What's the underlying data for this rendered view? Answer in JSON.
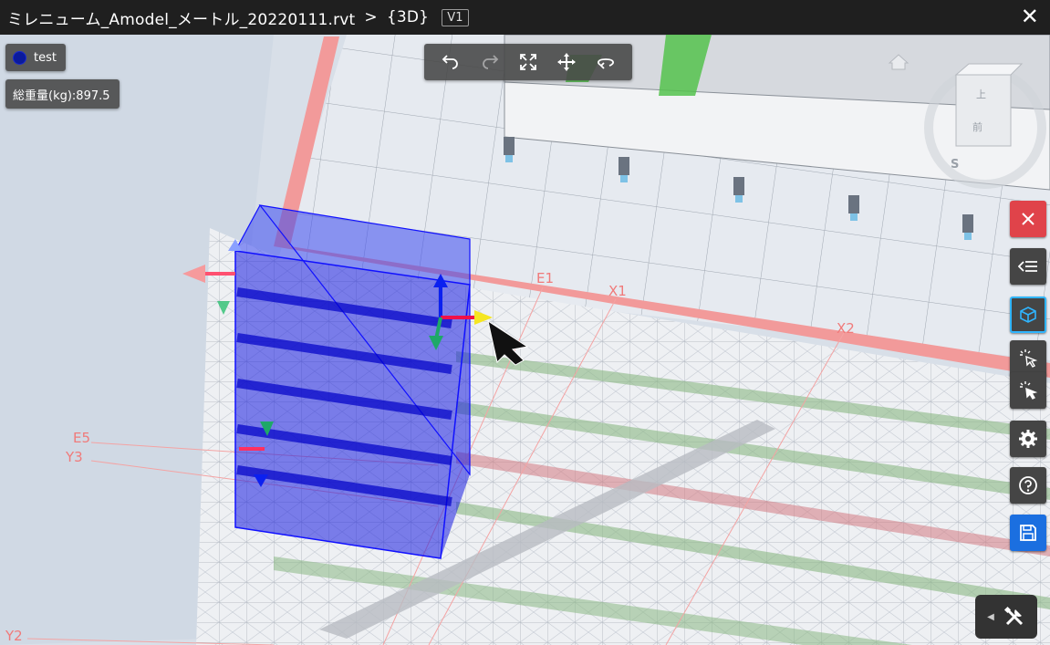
{
  "window": {
    "file_name": "ミレニューム_Amodel_メートル_20220111.rvt",
    "separator": ">",
    "view_name": "{3D}",
    "version": "V1",
    "close_glyph": "✕"
  },
  "legend": {
    "label": "test",
    "color": "#0a1a9c"
  },
  "weight": {
    "text": "総重量(kg):897.5"
  },
  "toolbar": {
    "items": [
      {
        "name": "undo-icon",
        "enabled": true
      },
      {
        "name": "redo-icon",
        "enabled": false
      },
      {
        "name": "fit-view-icon",
        "enabled": true
      },
      {
        "name": "pan-icon",
        "enabled": true
      },
      {
        "name": "orbit-icon",
        "enabled": true
      }
    ]
  },
  "viewcube": {
    "top": "上",
    "front": "前",
    "compass": "S"
  },
  "grid_labels": {
    "e1": "E1",
    "x1": "X1",
    "x2": "X2",
    "e5": "E5",
    "y3": "Y3",
    "y2": "Y2"
  },
  "side_toolbar": {
    "items": [
      {
        "name": "close-panel-button",
        "icon": "close-icon",
        "style": "red"
      },
      {
        "name": "collapse-panel-button",
        "icon": "collapse-list-icon",
        "style": "normal"
      },
      {
        "name": "cube-mode-button",
        "icon": "cube-icon",
        "style": "active"
      },
      {
        "name": "select-button",
        "icon": "pointer-select-icon",
        "style": "normal"
      },
      {
        "name": "multi-select-button",
        "icon": "pointer-multi-select-icon",
        "style": "normal"
      },
      {
        "name": "settings-button",
        "icon": "gear-icon",
        "style": "normal"
      },
      {
        "name": "help-button",
        "icon": "help-icon",
        "style": "normal"
      },
      {
        "name": "save-button",
        "icon": "floppy-disk-icon",
        "style": "blue"
      }
    ]
  },
  "tools_button": {
    "icon": "tools-icon",
    "chevron": "◀"
  },
  "colors": {
    "selection_blue": "#1a1ee0",
    "slab_edge_red": "#f08a8a",
    "grid_line": "#f4a3a3",
    "rail_green": "#7cb870"
  }
}
